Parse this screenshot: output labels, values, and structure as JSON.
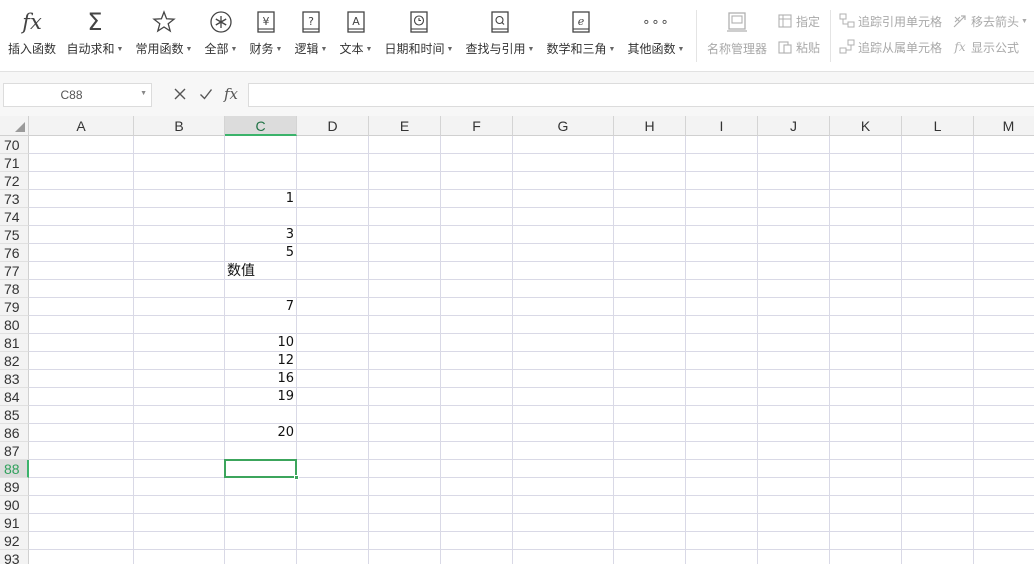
{
  "ribbon": {
    "insert_function": "插入函数",
    "auto_sum": "自动求和",
    "common_functions": "常用函数",
    "all": "全部",
    "finance": "财务",
    "logic": "逻辑",
    "text": "文本",
    "date_time": "日期和时间",
    "lookup_ref": "查找与引用",
    "math_trig": "数学和三角",
    "other_functions": "其他函数",
    "name_manager": "名称管理器",
    "define": "指定",
    "paste": "粘贴",
    "trace_precedents": "追踪引用单元格",
    "trace_dependents": "追踪从属单元格",
    "remove_arrows": "移去箭头",
    "show_formulas": "显示公式",
    "finance_glyph": "¥",
    "logic_glyph": "?",
    "text_glyph": "A",
    "math_glyph": "e",
    "other_glyph": "∘∘∘",
    "fx_glyph": "fx",
    "sum_glyph": "Σ"
  },
  "formula_bar": {
    "name_box": "C88",
    "formula": "",
    "fx_label": "fx"
  },
  "sheet": {
    "columns": [
      "A",
      "B",
      "C",
      "D",
      "E",
      "F",
      "G",
      "H",
      "I",
      "J",
      "K",
      "L",
      "M"
    ],
    "active_column": "C",
    "rows": [
      70,
      71,
      72,
      73,
      74,
      75,
      76,
      77,
      78,
      79,
      80,
      81,
      82,
      83,
      84,
      85,
      86,
      87,
      88,
      89,
      90,
      91,
      92,
      93
    ],
    "active_row": 88,
    "cells": [
      {
        "ref": "C73",
        "value": "1",
        "kind": "num"
      },
      {
        "ref": "C75",
        "value": "3",
        "kind": "num"
      },
      {
        "ref": "C76",
        "value": "5",
        "kind": "num"
      },
      {
        "ref": "C77",
        "value": "数值",
        "kind": "txt"
      },
      {
        "ref": "C79",
        "value": "7",
        "kind": "num"
      },
      {
        "ref": "C81",
        "value": "10",
        "kind": "num"
      },
      {
        "ref": "C82",
        "value": "12",
        "kind": "num"
      },
      {
        "ref": "C83",
        "value": "16",
        "kind": "num"
      },
      {
        "ref": "C84",
        "value": "19",
        "kind": "num"
      },
      {
        "ref": "C86",
        "value": "20",
        "kind": "num"
      }
    ]
  },
  "colors": {
    "accent": "#3ca55c",
    "header_bg": "#f3f3f3",
    "grid_line": "#d9d9e6"
  }
}
